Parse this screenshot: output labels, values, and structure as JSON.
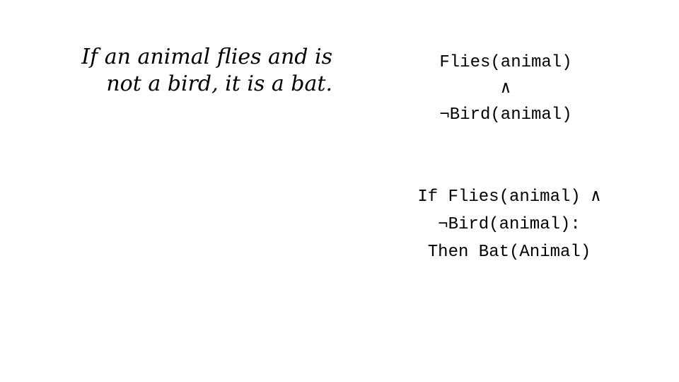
{
  "statement": {
    "line1": "If an animal flies and is",
    "line2": "not a bird, it is a bat."
  },
  "formula": {
    "line1": "Flies(animal)",
    "line2": "∧",
    "line3": "¬Bird(animal)"
  },
  "rule": {
    "line1": "If Flies(animal) ∧",
    "line2": "¬Bird(animal):",
    "line3": "Then Bat(Animal)"
  }
}
